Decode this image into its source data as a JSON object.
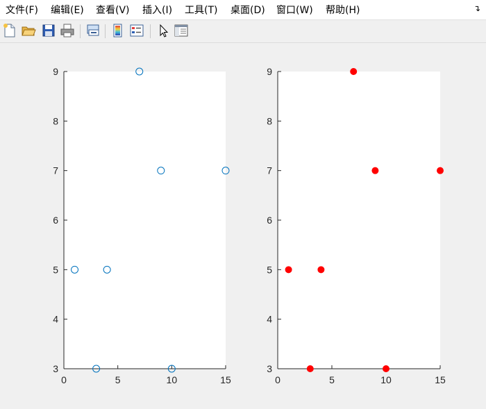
{
  "menubar": {
    "items": [
      "文件(F)",
      "编辑(E)",
      "查看(V)",
      "插入(I)",
      "工具(T)",
      "桌面(D)",
      "窗口(W)",
      "帮助(H)"
    ],
    "corner_icon": "dock-arrow-icon"
  },
  "toolbar": {
    "icons": [
      "new-figure-icon",
      "open-file-icon",
      "save-icon",
      "print-icon",
      "link-plot-icon",
      "colorbar-icon",
      "legend-icon",
      "edit-plot-pointer-icon",
      "property-inspector-icon"
    ]
  },
  "chart_data": [
    {
      "type": "scatter",
      "marker": "open-circle",
      "color": "#0072bd",
      "points": [
        {
          "x": 1,
          "y": 5
        },
        {
          "x": 3,
          "y": 3
        },
        {
          "x": 4,
          "y": 5
        },
        {
          "x": 7,
          "y": 9
        },
        {
          "x": 9,
          "y": 7
        },
        {
          "x": 10,
          "y": 3
        },
        {
          "x": 15,
          "y": 7
        }
      ],
      "xlim": [
        0,
        15
      ],
      "ylim": [
        3,
        9
      ],
      "xticks": [
        "0",
        "5",
        "10",
        "15"
      ],
      "yticks": [
        "3",
        "4",
        "5",
        "6",
        "7",
        "8",
        "9"
      ],
      "grid": false
    },
    {
      "type": "scatter",
      "marker": "filled-circle",
      "color": "#ff0000",
      "points": [
        {
          "x": 1,
          "y": 5
        },
        {
          "x": 3,
          "y": 3
        },
        {
          "x": 4,
          "y": 5
        },
        {
          "x": 7,
          "y": 9
        },
        {
          "x": 9,
          "y": 7
        },
        {
          "x": 10,
          "y": 3
        },
        {
          "x": 15,
          "y": 7
        }
      ],
      "xlim": [
        0,
        15
      ],
      "ylim": [
        3,
        9
      ],
      "xticks": [
        "0",
        "5",
        "10",
        "15"
      ],
      "yticks": [
        "3",
        "4",
        "5",
        "6",
        "7",
        "8",
        "9"
      ],
      "grid": false
    }
  ]
}
